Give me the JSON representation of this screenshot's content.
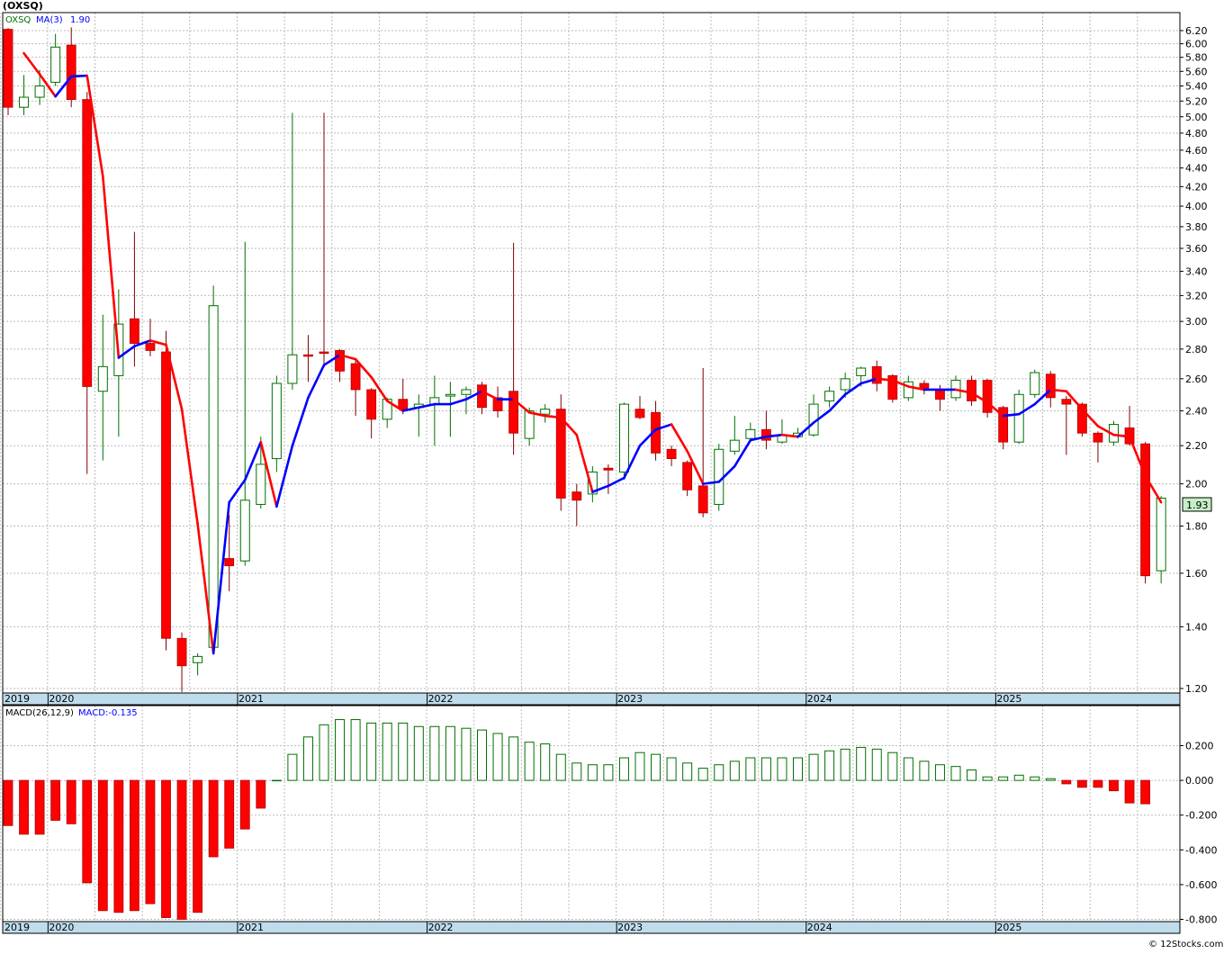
{
  "header": {
    "title": "(OXSQ)",
    "legend_symbol": "OXSQ",
    "legend_ma": "MA(3)",
    "legend_ma_value": "1.90",
    "macd_label": "MACD(26,12,9)",
    "macd_value": "MACD:-0.135",
    "last_price_label": "1.93",
    "footer": "© 12Stocks.com"
  },
  "colors": {
    "up_candle": "#007000",
    "down_candle": "#ff0000",
    "ma_rising": "#0000ff",
    "ma_falling": "#ff0000",
    "grid": "#bbbbbb",
    "date_bar": "#bfdcec",
    "last_price_bg": "#c6efc6"
  },
  "chart_data": [
    {
      "type": "candlestick",
      "scale": "log",
      "ylim": [
        1.2,
        6.2
      ],
      "y_ticks": [
        "1.20",
        "1.40",
        "1.60",
        "1.80",
        "2.00",
        "2.20",
        "2.40",
        "2.60",
        "2.80",
        "3.00",
        "3.20",
        "3.40",
        "3.60",
        "3.80",
        "4.00",
        "4.20",
        "4.40",
        "4.60",
        "4.80",
        "5.00",
        "5.20",
        "5.40",
        "5.60",
        "5.80",
        "6.00",
        "6.20"
      ],
      "x_labels": [
        "2019",
        "2020",
        "2021",
        "2022",
        "2023",
        "2024",
        "2025"
      ],
      "grid": true,
      "series": [
        {
          "name": "OXSQ",
          "candles": [
            [
              6.22,
              6.24,
              5.02,
              5.12
            ],
            [
              5.12,
              5.55,
              5.02,
              5.25
            ],
            [
              5.25,
              5.62,
              5.15,
              5.4
            ],
            [
              5.45,
              6.15,
              5.4,
              5.95
            ],
            [
              5.98,
              6.25,
              5.12,
              5.22
            ],
            [
              5.22,
              5.32,
              2.05,
              2.55
            ],
            [
              2.52,
              3.05,
              2.12,
              2.68
            ],
            [
              2.62,
              3.25,
              2.25,
              2.98
            ],
            [
              3.02,
              3.75,
              2.68,
              2.84
            ],
            [
              2.84,
              3.02,
              2.75,
              2.79
            ],
            [
              2.78,
              2.93,
              1.32,
              1.36
            ],
            [
              1.36,
              1.38,
              1.19,
              1.27
            ],
            [
              1.28,
              1.31,
              1.24,
              1.3
            ],
            [
              1.33,
              3.28,
              1.31,
              3.12
            ],
            [
              1.66,
              1.85,
              1.53,
              1.63
            ],
            [
              1.65,
              3.66,
              1.63,
              1.92
            ],
            [
              1.9,
              2.25,
              1.88,
              2.1
            ],
            [
              2.13,
              2.62,
              2.06,
              2.57
            ],
            [
              2.57,
              5.05,
              2.53,
              2.76
            ],
            [
              2.76,
              2.9,
              2.58,
              2.75
            ],
            [
              2.78,
              5.05,
              2.68,
              2.77
            ],
            [
              2.79,
              2.8,
              2.58,
              2.65
            ],
            [
              2.7,
              2.72,
              2.37,
              2.53
            ],
            [
              2.53,
              2.54,
              2.24,
              2.35
            ],
            [
              2.35,
              2.48,
              2.3,
              2.47
            ],
            [
              2.47,
              2.6,
              2.38,
              2.41
            ],
            [
              2.42,
              2.5,
              2.25,
              2.44
            ],
            [
              2.44,
              2.62,
              2.2,
              2.48
            ],
            [
              2.49,
              2.58,
              2.25,
              2.5
            ],
            [
              2.5,
              2.55,
              2.38,
              2.53
            ],
            [
              2.56,
              2.58,
              2.38,
              2.42
            ],
            [
              2.48,
              2.55,
              2.36,
              2.4
            ],
            [
              2.52,
              3.65,
              2.15,
              2.27
            ],
            [
              2.24,
              2.42,
              2.2,
              2.4
            ],
            [
              2.38,
              2.44,
              2.33,
              2.41
            ],
            [
              2.41,
              2.5,
              1.87,
              1.93
            ],
            [
              1.96,
              2.0,
              1.8,
              1.92
            ],
            [
              1.95,
              2.09,
              1.91,
              2.06
            ],
            [
              2.08,
              2.1,
              1.95,
              2.07
            ],
            [
              2.06,
              2.45,
              2.02,
              2.44
            ],
            [
              2.41,
              2.49,
              2.35,
              2.36
            ],
            [
              2.39,
              2.46,
              2.12,
              2.16
            ],
            [
              2.18,
              2.2,
              2.09,
              2.13
            ],
            [
              2.11,
              2.12,
              1.94,
              1.97
            ],
            [
              1.99,
              2.67,
              1.84,
              1.86
            ],
            [
              1.9,
              2.21,
              1.87,
              2.18
            ],
            [
              2.17,
              2.37,
              2.15,
              2.23
            ],
            [
              2.24,
              2.33,
              2.23,
              2.29
            ],
            [
              2.29,
              2.4,
              2.18,
              2.23
            ],
            [
              2.22,
              2.35,
              2.21,
              2.26
            ],
            [
              2.25,
              2.3,
              2.24,
              2.27
            ],
            [
              2.26,
              2.5,
              2.25,
              2.44
            ],
            [
              2.46,
              2.55,
              2.42,
              2.52
            ],
            [
              2.53,
              2.64,
              2.48,
              2.6
            ],
            [
              2.62,
              2.68,
              2.55,
              2.67
            ],
            [
              2.68,
              2.72,
              2.52,
              2.57
            ],
            [
              2.62,
              2.63,
              2.45,
              2.47
            ],
            [
              2.48,
              2.62,
              2.46,
              2.58
            ],
            [
              2.57,
              2.59,
              2.5,
              2.54
            ],
            [
              2.53,
              2.56,
              2.4,
              2.47
            ],
            [
              2.48,
              2.62,
              2.46,
              2.59
            ],
            [
              2.59,
              2.62,
              2.43,
              2.46
            ],
            [
              2.59,
              2.6,
              2.36,
              2.39
            ],
            [
              2.42,
              2.43,
              2.18,
              2.22
            ],
            [
              2.22,
              2.53,
              2.21,
              2.5
            ],
            [
              2.5,
              2.66,
              2.48,
              2.64
            ],
            [
              2.63,
              2.65,
              2.42,
              2.48
            ],
            [
              2.47,
              2.49,
              2.15,
              2.44
            ],
            [
              2.44,
              2.45,
              2.25,
              2.27
            ],
            [
              2.27,
              2.28,
              2.11,
              2.22
            ],
            [
              2.22,
              2.34,
              2.2,
              2.32
            ],
            [
              2.3,
              2.43,
              2.2,
              2.21
            ],
            [
              2.21,
              2.22,
              1.56,
              1.59
            ],
            [
              1.61,
              1.94,
              1.56,
              1.93
            ]
          ]
        },
        {
          "name": "MA(3)",
          "values": [
            null,
            5.86,
            5.56,
            5.26,
            5.53,
            5.54,
            4.31,
            2.74,
            2.82,
            2.86,
            2.83,
            2.41,
            1.81,
            1.31,
            1.91,
            2.02,
            2.22,
            1.89,
            2.2,
            2.48,
            2.69,
            2.76,
            2.73,
            2.61,
            2.46,
            2.4,
            2.42,
            2.44,
            2.44,
            2.47,
            2.52,
            2.47,
            2.47,
            2.39,
            2.37,
            2.36,
            2.26,
            1.96,
            1.99,
            2.03,
            2.2,
            2.29,
            2.32,
            2.17,
            2.0,
            2.01,
            2.09,
            2.23,
            2.25,
            2.26,
            2.25,
            2.33,
            2.4,
            2.5,
            2.57,
            2.6,
            2.59,
            2.55,
            2.53,
            2.53,
            2.53,
            2.51,
            2.45,
            2.37,
            2.38,
            2.44,
            2.53,
            2.52,
            2.41,
            2.31,
            2.26,
            2.25,
            2.04,
            1.91
          ]
        }
      ]
    },
    {
      "type": "bar",
      "name": "MACD(26,12,9)",
      "ylim": [
        -0.8,
        0.35
      ],
      "y_ticks": [
        "-0.800",
        "-0.600",
        "-0.400",
        "-0.200",
        "0.000",
        "0.200"
      ],
      "x_labels": [
        "2019",
        "2020",
        "2021",
        "2022",
        "2023",
        "2024",
        "2025"
      ],
      "values": [
        -0.26,
        -0.31,
        -0.31,
        -0.23,
        -0.25,
        -0.59,
        -0.75,
        -0.76,
        -0.75,
        -0.71,
        -0.79,
        -0.8,
        -0.76,
        -0.44,
        -0.39,
        -0.28,
        -0.16,
        0.0,
        0.15,
        0.25,
        0.32,
        0.35,
        0.35,
        0.33,
        0.33,
        0.33,
        0.31,
        0.31,
        0.31,
        0.3,
        0.29,
        0.27,
        0.25,
        0.22,
        0.21,
        0.15,
        0.1,
        0.09,
        0.09,
        0.13,
        0.16,
        0.15,
        0.13,
        0.1,
        0.07,
        0.09,
        0.11,
        0.13,
        0.13,
        0.13,
        0.13,
        0.15,
        0.17,
        0.18,
        0.19,
        0.18,
        0.16,
        0.13,
        0.11,
        0.09,
        0.08,
        0.06,
        0.02,
        0.02,
        0.03,
        0.02,
        0.01,
        -0.02,
        -0.04,
        -0.04,
        -0.06,
        -0.13,
        -0.135
      ]
    }
  ]
}
